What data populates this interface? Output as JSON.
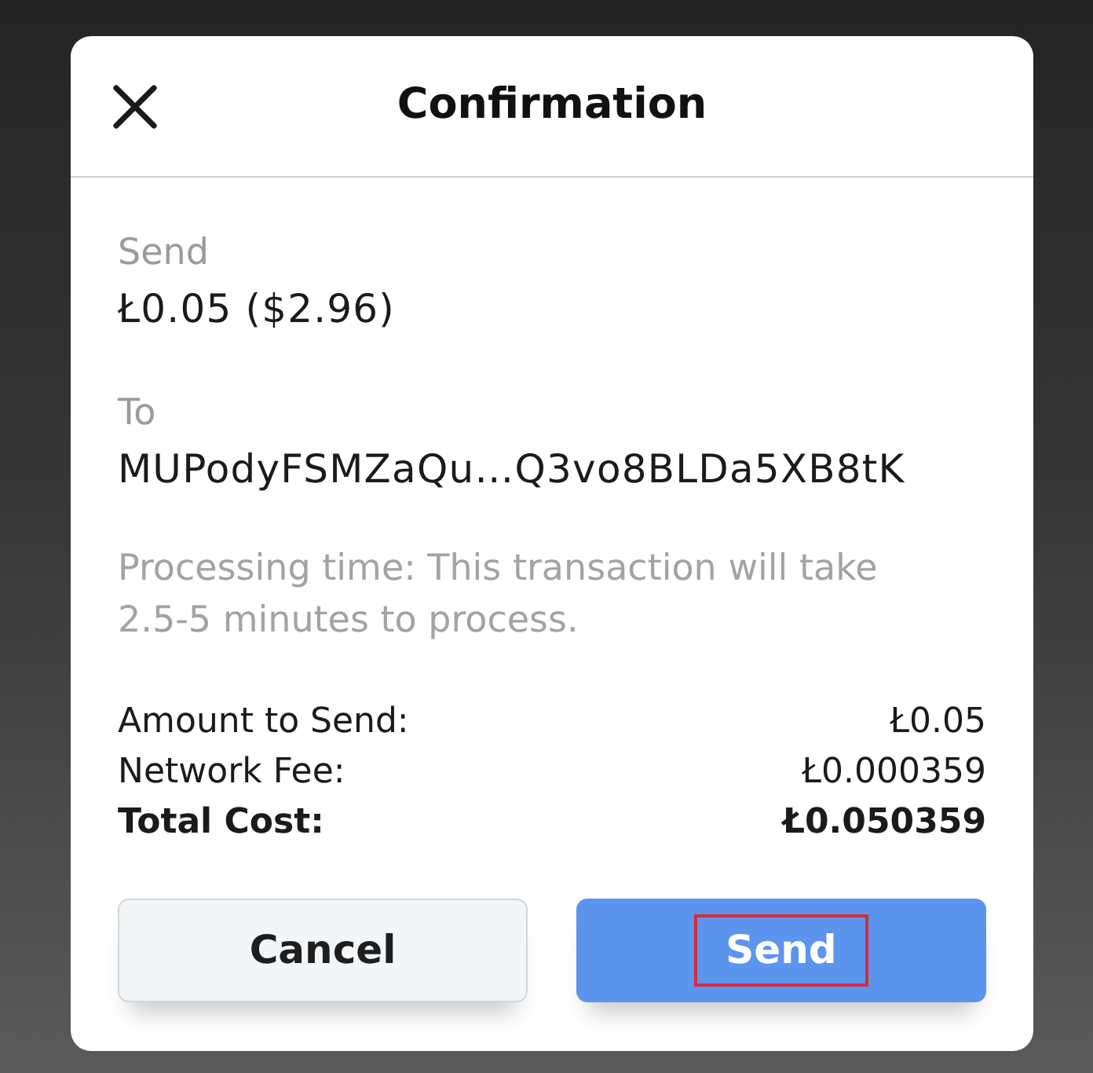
{
  "dialog": {
    "title": "Confirmation"
  },
  "fields": [
    {
      "label": "Send",
      "value": "Ł0.05 ($2.96)"
    },
    {
      "label": "To",
      "value": "MUPodyFSMZaQu…Q3vo8BLDa5XB8tK"
    }
  ],
  "notice": "Processing time: This transaction will take 2.5-5 minutes to process.",
  "summary": [
    {
      "label": "Amount to Send:",
      "value": "Ł0.05",
      "kind": "item"
    },
    {
      "label": "Network Fee:",
      "value": "Ł0.000359",
      "kind": "item"
    },
    {
      "label": "Total Cost:",
      "value": "Ł0.050359",
      "kind": "total"
    }
  ],
  "buttons": [
    {
      "label": "Cancel",
      "kind": "secondary",
      "highlighted": false
    },
    {
      "label": "Send",
      "kind": "primary",
      "highlighted": true
    }
  ]
}
